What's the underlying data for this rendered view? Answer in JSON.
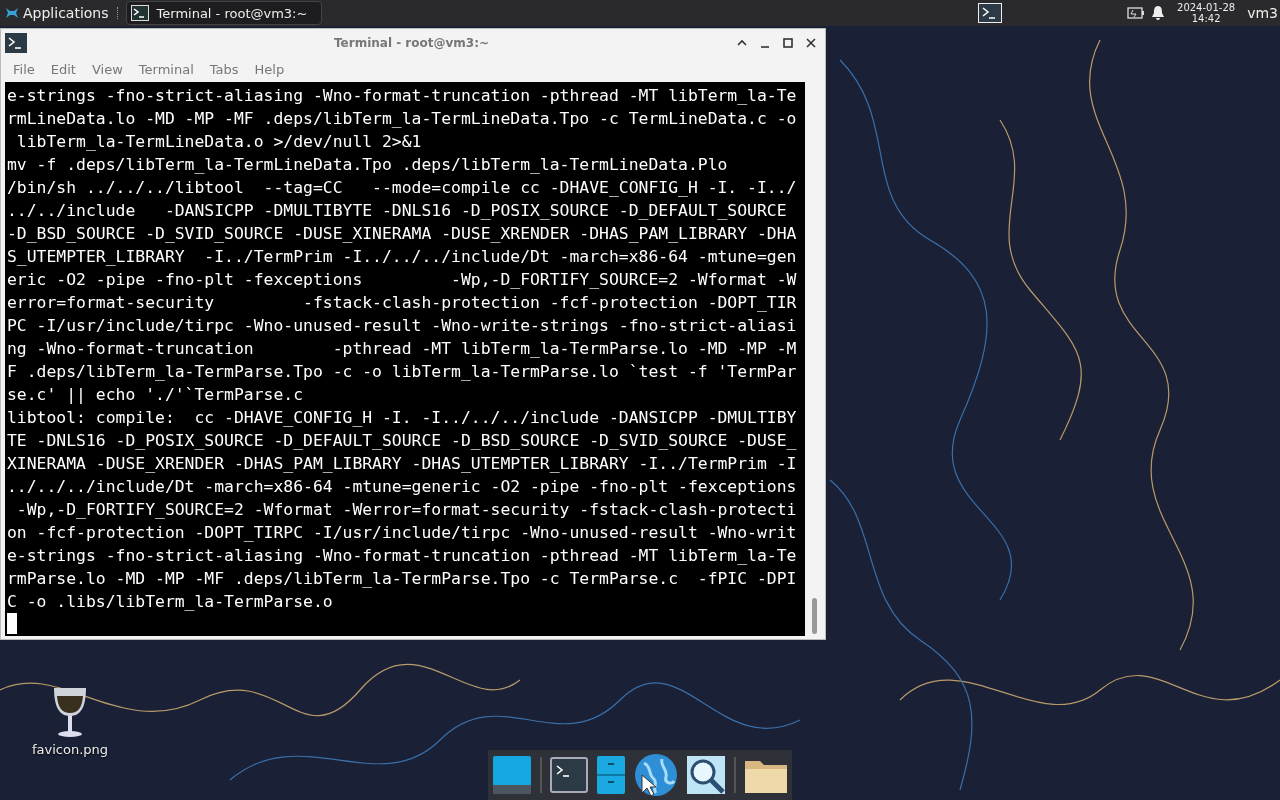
{
  "top_panel": {
    "applications_label": "Applications",
    "tasks": [
      {
        "title": "Terminal - root@vm3:~",
        "selected": true
      }
    ],
    "date": "2024-01-28",
    "time": "14:42",
    "user": "vm3"
  },
  "desktop_icons": [
    {
      "label": "favicon.png"
    }
  ],
  "window": {
    "title": "Terminal - root@vm3:~",
    "menu": [
      "File",
      "Edit",
      "View",
      "Terminal",
      "Tabs",
      "Help"
    ],
    "lines": [
      "e-strings -fno-strict-aliasing -Wno-format-truncation -pthread -MT libTerm_la-Te",
      "rmLineData.lo -MD -MP -MF .deps/libTerm_la-TermLineData.Tpo -c TermLineData.c -o",
      " libTerm_la-TermLineData.o >/dev/null 2>&1",
      "mv -f .deps/libTerm_la-TermLineData.Tpo .deps/libTerm_la-TermLineData.Plo",
      "/bin/sh ../../../libtool  --tag=CC   --mode=compile cc -DHAVE_CONFIG_H -I. -I../",
      "../../include   -DANSICPP -DMULTIBYTE -DNLS16 -D_POSIX_SOURCE -D_DEFAULT_SOURCE",
      "-D_BSD_SOURCE -D_SVID_SOURCE -DUSE_XINERAMA -DUSE_XRENDER -DHAS_PAM_LIBRARY -DHA",
      "S_UTEMPTER_LIBRARY  -I../TermPrim -I../../../include/Dt -march=x86-64 -mtune=gen",
      "eric -O2 -pipe -fno-plt -fexceptions         -Wp,-D_FORTIFY_SOURCE=2 -Wformat -W",
      "error=format-security         -fstack-clash-protection -fcf-protection -DOPT_TIR",
      "PC -I/usr/include/tirpc -Wno-unused-result -Wno-write-strings -fno-strict-aliasi",
      "ng -Wno-format-truncation        -pthread -MT libTerm_la-TermParse.lo -MD -MP -M",
      "F .deps/libTerm_la-TermParse.Tpo -c -o libTerm_la-TermParse.lo `test -f 'TermPar",
      "se.c' || echo './'`TermParse.c",
      "libtool: compile:  cc -DHAVE_CONFIG_H -I. -I../../../include -DANSICPP -DMULTIBY",
      "TE -DNLS16 -D_POSIX_SOURCE -D_DEFAULT_SOURCE -D_BSD_SOURCE -D_SVID_SOURCE -DUSE_",
      "XINERAMA -DUSE_XRENDER -DHAS_PAM_LIBRARY -DHAS_UTEMPTER_LIBRARY -I../TermPrim -I",
      "../../../include/Dt -march=x86-64 -mtune=generic -O2 -pipe -fno-plt -fexceptions",
      " -Wp,-D_FORTIFY_SOURCE=2 -Wformat -Werror=format-security -fstack-clash-protecti",
      "on -fcf-protection -DOPT_TIRPC -I/usr/include/tirpc -Wno-unused-result -Wno-writ",
      "e-strings -fno-strict-aliasing -Wno-format-truncation -pthread -MT libTerm_la-Te",
      "rmParse.lo -MD -MP -MF .deps/libTerm_la-TermParse.Tpo -c TermParse.c  -fPIC -DPI",
      "C -o .libs/libTerm_la-TermParse.o"
    ]
  },
  "dock": [
    {
      "kind": "desktop"
    },
    {
      "kind": "separator"
    },
    {
      "kind": "terminal"
    },
    {
      "kind": "cabinet"
    },
    {
      "kind": "globe"
    },
    {
      "kind": "search"
    },
    {
      "kind": "separator"
    },
    {
      "kind": "folder"
    }
  ]
}
